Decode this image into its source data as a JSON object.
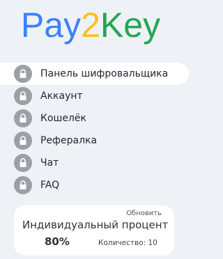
{
  "logo": {
    "part1": "Pay",
    "part2": "2",
    "part3": "Key",
    "colors": {
      "pay": "#3b82f6",
      "two": "#fbbf24",
      "key": "#22a653"
    }
  },
  "menu": {
    "items": [
      {
        "label": "Панель шифровальщика",
        "icon": "lock-icon",
        "active": true
      },
      {
        "label": "Аккаунт",
        "icon": "lock-icon",
        "active": false
      },
      {
        "label": "Кошелёк",
        "icon": "lock-icon",
        "active": false
      },
      {
        "label": "Рефералка",
        "icon": "lock-icon",
        "active": false
      },
      {
        "label": "Чат",
        "icon": "lock-icon",
        "active": false
      },
      {
        "label": "FAQ",
        "icon": "lock-icon",
        "active": false
      }
    ]
  },
  "card": {
    "refresh_label": "Обновить",
    "title": "Индивидуальный процент",
    "percent": "80%",
    "quantity": "Количество: 10"
  }
}
